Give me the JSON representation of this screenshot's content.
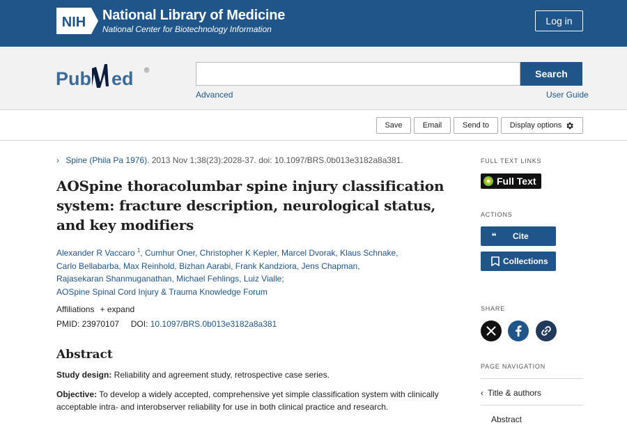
{
  "header": {
    "nih_mark": "NIH",
    "title": "National Library of Medicine",
    "subtitle": "National Center for Biotechnology Information",
    "login_label": "Log in"
  },
  "search": {
    "logo_text_left": "Pub",
    "logo_text_right": "ed",
    "logo_reg": "®",
    "value": "",
    "button_label": "Search",
    "advanced_label": "Advanced",
    "guide_label": "User Guide"
  },
  "toolbar": {
    "save_label": "Save",
    "email_label": "Email",
    "sendto_label": "Send to",
    "display_label": "Display options"
  },
  "article": {
    "journal": "Spine (Phila Pa 1976)",
    "citation": ". 2013 Nov 1;38(23):2028-37. doi: 10.1097/BRS.0b013e3182a8a381.",
    "title": "AOSpine thoracolumbar spine injury classification system: fracture description, neurological status, and key modifiers",
    "first_author": "Alexander R Vaccaro",
    "first_author_sup": "1",
    "authors_rest_1": ", Cumhur Oner, Christopher K Kepler, Marcel Dvorak, Klaus Schnake,",
    "authors_line_2": "Carlo Bellabarba, Max Reinhold, Bizhan Aarabi, Frank Kandziora, Jens Chapman,",
    "authors_line_3": "Rajasekaran Shanmuganathan, Michael Fehlings, Luiz Vialle;",
    "authors_line_4": "AOSpine Spinal Cord Injury & Trauma Knowledge Forum",
    "affiliations_label": "Affiliations",
    "expand_label": "+ expand",
    "pmid_label": "PMID: 23970107",
    "doi_label": "DOI:",
    "doi_value": "10.1097/BRS.0b013e3182a8a381",
    "abstract_heading": "Abstract",
    "study_design_label": "Study design:",
    "study_design_text": " Reliability and agreement study, retrospective case series.",
    "objective_label": "Objective:",
    "objective_text": " To develop a widely accepted, comprehensive yet simple classification system with clinically acceptable intra- and interobserver reliability for use in both clinical practice and research."
  },
  "sidebar": {
    "full_text_links_label": "FULL TEXT LINKS",
    "full_text_button": "Full Text",
    "actions_label": "ACTIONS",
    "cite_label": "Cite",
    "collections_label": "Collections",
    "share_label": "SHARE",
    "page_nav_label": "PAGE NAVIGATION",
    "nav_items": [
      "Title & authors",
      "Abstract"
    ]
  },
  "colors": {
    "nih_blue": "#20558a",
    "band_gray": "#f2f2f2",
    "facebook_blue": "#20558a"
  },
  "icons": [
    "nih-logo-icon",
    "pubmed-logo-icon",
    "gear-icon",
    "chevron-right-icon",
    "quote-icon",
    "bookmark-icon",
    "x-twitter-icon",
    "facebook-icon",
    "link-icon",
    "chevron-left-icon"
  ]
}
